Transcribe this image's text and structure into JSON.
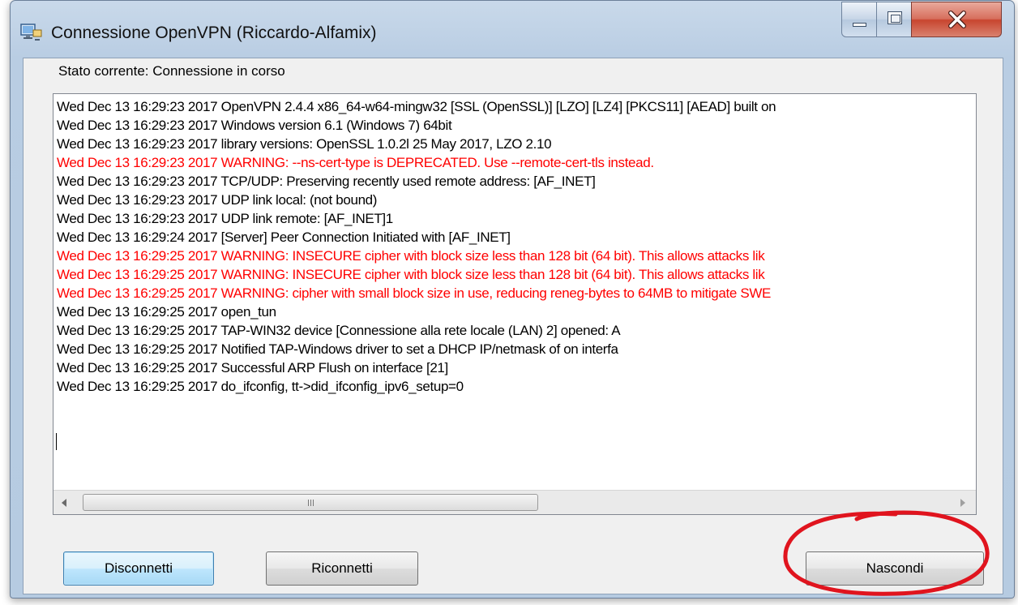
{
  "window": {
    "title": "Connessione OpenVPN (Riccardo-Alfamix)",
    "icon": "openvpn-monitor-icon"
  },
  "status": {
    "text": "Stato corrente: Connessione in corso"
  },
  "log": {
    "lines": [
      {
        "text": "Wed Dec 13 16:29:23 2017 OpenVPN 2.4.4 x86_64-w64-mingw32 [SSL (OpenSSL)] [LZO] [LZ4] [PKCS11] [AEAD] built on",
        "level": "info"
      },
      {
        "text": "Wed Dec 13 16:29:23 2017 Windows version 6.1 (Windows 7) 64bit",
        "level": "info"
      },
      {
        "text": "Wed Dec 13 16:29:23 2017 library versions: OpenSSL 1.0.2l  25 May 2017, LZO 2.10",
        "level": "info"
      },
      {
        "text": "Wed Dec 13 16:29:23 2017 WARNING: --ns-cert-type is DEPRECATED.  Use --remote-cert-tls instead.",
        "level": "warning"
      },
      {
        "text": "Wed Dec 13 16:29:23 2017 TCP/UDP: Preserving recently used remote address: [AF_INET]",
        "level": "info"
      },
      {
        "text": "Wed Dec 13 16:29:23 2017 UDP link local: (not bound)",
        "level": "info"
      },
      {
        "text": "Wed Dec 13 16:29:23 2017 UDP link remote: [AF_INET]1",
        "level": "info"
      },
      {
        "text": "Wed Dec 13 16:29:24 2017 [Server] Peer Connection Initiated with [AF_INET]",
        "level": "info"
      },
      {
        "text": "Wed Dec 13 16:29:25 2017 WARNING: INSECURE cipher with block size less than 128 bit (64 bit).  This allows attacks lik",
        "level": "warning"
      },
      {
        "text": "Wed Dec 13 16:29:25 2017 WARNING: INSECURE cipher with block size less than 128 bit (64 bit).  This allows attacks lik",
        "level": "warning"
      },
      {
        "text": "Wed Dec 13 16:29:25 2017 WARNING: cipher with small block size in use, reducing reneg-bytes to 64MB to mitigate SWE",
        "level": "warning"
      },
      {
        "text": "Wed Dec 13 16:29:25 2017 open_tun",
        "level": "info"
      },
      {
        "text": "Wed Dec 13 16:29:25 2017 TAP-WIN32 device [Connessione alla rete locale (LAN) 2] opened:                    A",
        "level": "info"
      },
      {
        "text": "Wed Dec 13 16:29:25 2017 Notified TAP-Windows driver to set a DHCP IP/netmask of                                  on interfa",
        "level": "info"
      },
      {
        "text": "Wed Dec 13 16:29:25 2017 Successful ARP Flush on interface [21]",
        "level": "info"
      },
      {
        "text": "Wed Dec 13 16:29:25 2017 do_ifconfig, tt->did_ifconfig_ipv6_setup=0",
        "level": "info"
      }
    ]
  },
  "scrollbar": {
    "left_icon": "scroll-left-arrow-icon",
    "right_icon": "scroll-right-arrow-icon",
    "grip_label": "III"
  },
  "buttons": {
    "disconnect": "Disconnetti",
    "reconnect": "Riconnetti",
    "hide": "Nascondi"
  },
  "colors": {
    "warning_text": "#ff0000",
    "annotation": "#e0141e"
  }
}
